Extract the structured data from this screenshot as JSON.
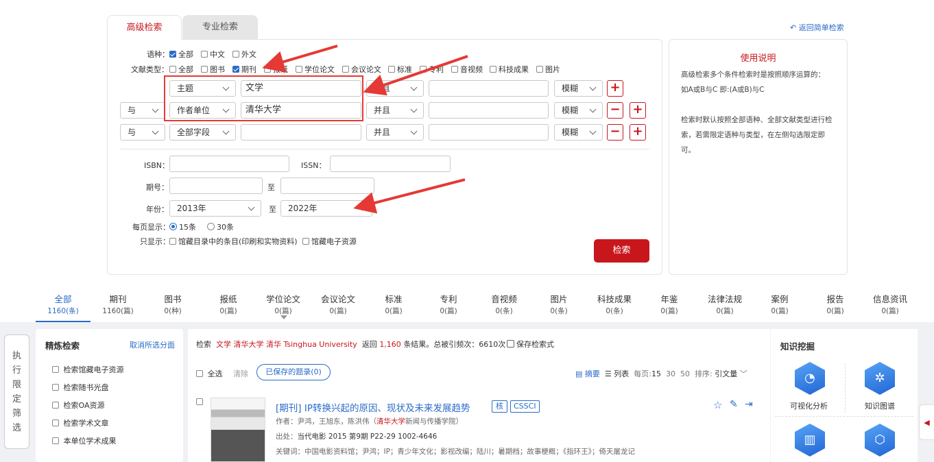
{
  "tabs": {
    "advanced": "高级检索",
    "professional": "专业检索"
  },
  "back_link": "返回简单检索",
  "lang": {
    "label": "语种：",
    "options": [
      "全部",
      "中文",
      "外文"
    ],
    "checked": [
      true,
      false,
      false
    ]
  },
  "doctype": {
    "label": "文献类型：",
    "options": [
      "全部",
      "图书",
      "期刊",
      "报纸",
      "学位论文",
      "会议论文",
      "标准",
      "专利",
      "音视频",
      "科技成果",
      "图片"
    ],
    "checked": [
      false,
      false,
      true,
      false,
      false,
      false,
      false,
      false,
      false,
      false,
      false
    ]
  },
  "rows": [
    {
      "logic": "",
      "field": "主题",
      "value": "文学",
      "op": "并且",
      "value2": "",
      "match": "模糊"
    },
    {
      "logic": "与",
      "field": "作者单位",
      "value": "清华大学",
      "op": "并且",
      "value2": "",
      "match": "模糊"
    },
    {
      "logic": "与",
      "field": "全部字段",
      "value": "",
      "op": "并且",
      "value2": "",
      "match": "模糊"
    }
  ],
  "isbn_label": "ISBN：",
  "issn_label": "ISSN：",
  "issue_label": "期号：",
  "to": "至",
  "year_label": "年份：",
  "year_from": "2013年",
  "year_to": "2022年",
  "perpage": {
    "label": "每页显示：",
    "options": [
      "15条",
      "30条"
    ]
  },
  "onlyshow": {
    "label": "只显示：",
    "options": [
      "馆藏目录中的条目(印刷和实物资料)",
      "馆藏电子资源"
    ]
  },
  "search_button": "检索",
  "help": {
    "title": "使用说明",
    "p1": "高级检索多个条件检索时是按照顺序运算的：",
    "p2": "如A或B与C 即:(A或B)与C",
    "p3": "检索时默认按照全部语种、全部文献类型进行检索，若需限定语种与类型，在左侧勾选限定即可。"
  },
  "categories": [
    {
      "name": "全部",
      "count": "1160(条)"
    },
    {
      "name": "期刊",
      "count": "1160(篇)"
    },
    {
      "name": "图书",
      "count": "0(种)"
    },
    {
      "name": "报纸",
      "count": "0(篇)"
    },
    {
      "name": "学位论文",
      "count": "0(篇)"
    },
    {
      "name": "会议论文",
      "count": "0(篇)"
    },
    {
      "name": "标准",
      "count": "0(篇)"
    },
    {
      "name": "专利",
      "count": "0(篇)"
    },
    {
      "name": "音视频",
      "count": "0(条)"
    },
    {
      "name": "图片",
      "count": "0(条)"
    },
    {
      "name": "科技成果",
      "count": "0(条)"
    },
    {
      "name": "年鉴",
      "count": "0(篇)"
    },
    {
      "name": "法律法规",
      "count": "0(篇)"
    },
    {
      "name": "案例",
      "count": "0(篇)"
    },
    {
      "name": "报告",
      "count": "0(篇)"
    },
    {
      "name": "信息资讯",
      "count": "0(篇)"
    }
  ],
  "side_label": "执行限定筛选",
  "refine": {
    "title": "精炼检索",
    "cancel": "取消所选分面",
    "items": [
      "检索馆藏电子资源",
      "检索随书光盘",
      "检索OA资源",
      "检索学术文章",
      "本单位学术成果"
    ]
  },
  "results": {
    "prefix": "检索",
    "terms": "文学 清华大学 清华 Tsinghua University",
    "returned": "返回",
    "count": "1,160",
    "suffix": "条结果。总被引频次：6610次",
    "save_query": "保存检索式",
    "select_all": "全选",
    "clear": "清除",
    "saved": "已保存的题录(0)",
    "view_abstract": "摘要",
    "view_list": "列表",
    "perpage_label": "每页:",
    "perpage_options": [
      "15",
      "30",
      "50"
    ],
    "sort_label": "排序:",
    "sort_value": "引文量"
  },
  "record": {
    "type": "[期刊]",
    "title": "IP转换兴起的原因、现状及未来发展趋势",
    "badges": [
      "核",
      "CSSCI"
    ],
    "authors_label": "作者：",
    "authors": "尹鸿，王旭东，陈洪伟（",
    "affil_hl": "清华大学",
    "affil_rest": "新闻与传播学院）",
    "source_label": "出处：",
    "source": "当代电影 2015 第9期 P22-29  1002-4646",
    "keywords_label": "关键词：",
    "keywords": "中国电影资料馆；尹鸿；IP；青少年文化；影视改编；陆川；暑期档；故事梗概；《指环王》；倚天屠龙记"
  },
  "knowledge": {
    "title": "知识挖掘",
    "items": [
      "可视化分析",
      "知识图谱"
    ]
  }
}
